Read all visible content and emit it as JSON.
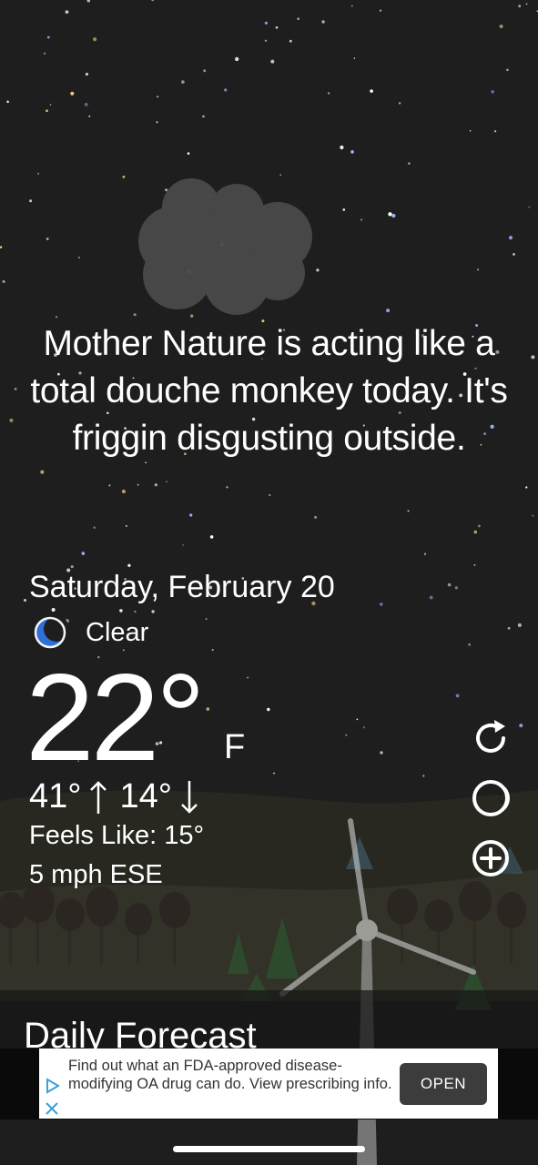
{
  "weather": {
    "tagline": "Mother Nature is acting like a total douche monkey today. It's friggin disgusting outside.",
    "date": "Saturday, February 20",
    "condition": "Clear",
    "condition_icon": "crescent-moon-icon",
    "temperature": "22°",
    "unit": "F",
    "high": "41°",
    "low": "14°",
    "feels_like": "Feels Like: 15°",
    "wind": "5 mph ESE"
  },
  "actions": {
    "refresh_icon": "refresh-icon",
    "theme_icon": "moon-phase-icon",
    "add_icon": "add-circle-icon"
  },
  "forecast": {
    "title": "Daily Forecast"
  },
  "ad": {
    "text": "Find out what an FDA-approved disease-modifying OA drug can do. View prescribing info.",
    "button_label": "OPEN"
  },
  "colors": {
    "background": "#1e1e1f",
    "moon_icon": "#3b7be0",
    "ad_button": "#3c3c3c"
  }
}
